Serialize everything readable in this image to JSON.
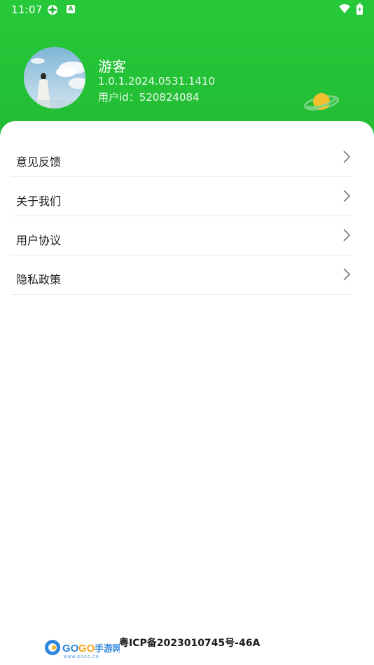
{
  "status_bar": {
    "time": "11:07",
    "icons": [
      "gear-notification-icon",
      "a-notification-icon",
      "wifi-icon",
      "battery-icon"
    ]
  },
  "profile": {
    "name": "游客",
    "version": "1.0.1.2024.0531.1410",
    "uid_label": "用户id：",
    "uid_value": "520824084",
    "avatar": "avatar-photo",
    "decoration": "planet-icon"
  },
  "menu": {
    "items": [
      {
        "label": "意见反馈"
      },
      {
        "label": "关于我们"
      },
      {
        "label": "用户协议"
      },
      {
        "label": "隐私政策"
      }
    ]
  },
  "footer": {
    "logo_text": "GOGO手游网",
    "logo_sub": "WWW.GOGO.CN",
    "icp": "粤ICP备2023010745号-46A"
  },
  "colors": {
    "header_green": "#22bb33",
    "text_dark": "#1b1b1b",
    "divider": "#e9e9e9",
    "planet": "#f2c12e"
  }
}
